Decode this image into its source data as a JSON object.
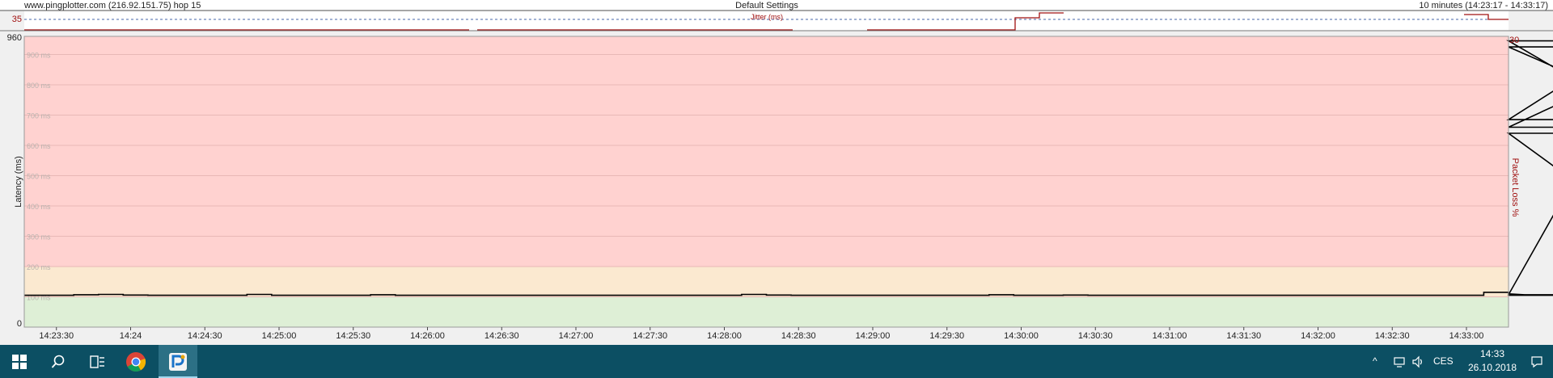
{
  "header": {
    "target": "www.pingplotter.com (216.92.151.75) hop 15",
    "settings": "Default Settings",
    "range": "10 minutes (14:23:17 - 14:33:17)"
  },
  "jitter": {
    "label": "Jitter (ms)",
    "scale_value": "35"
  },
  "chart_data": {
    "type": "line",
    "title": "",
    "ylabel": "Latency (ms)",
    "y2label": "Packet Loss %",
    "ylim": [
      0,
      960
    ],
    "y_top_label": "960",
    "y_bottom_label": "0",
    "y2_top_label": "30",
    "grid_labels": [
      "100 ms",
      "200 ms",
      "300 ms",
      "400 ms",
      "500 ms",
      "600 ms",
      "700 ms",
      "800 ms",
      "900 ms"
    ],
    "grid_values": [
      100,
      200,
      300,
      400,
      500,
      600,
      700,
      800,
      900
    ],
    "zones": [
      {
        "name": "good",
        "from": 0,
        "to": 100,
        "color": "#deefd6"
      },
      {
        "name": "warning",
        "from": 100,
        "to": 200,
        "color": "#fbe9d0"
      },
      {
        "name": "bad",
        "from": 200,
        "to": 960,
        "color": "#ffd2d0"
      }
    ],
    "x_range": [
      "14:23:17",
      "14:33:17"
    ],
    "x_ticks": [
      {
        "t": "14:23:30",
        "label": "14:23:30"
      },
      {
        "t": "14:24:00",
        "label": "14:24"
      },
      {
        "t": "14:24:30",
        "label": "14:24:30"
      },
      {
        "t": "14:25:00",
        "label": "14:25:00"
      },
      {
        "t": "14:25:30",
        "label": "14:25:30"
      },
      {
        "t": "14:26:00",
        "label": "14:26:00"
      },
      {
        "t": "14:26:30",
        "label": "14:26:30"
      },
      {
        "t": "14:27:00",
        "label": "14:27:00"
      },
      {
        "t": "14:27:30",
        "label": "14:27:30"
      },
      {
        "t": "14:28:00",
        "label": "14:28:00"
      },
      {
        "t": "14:28:30",
        "label": "14:28:30"
      },
      {
        "t": "14:29:00",
        "label": "14:29:00"
      },
      {
        "t": "14:29:30",
        "label": "14:29:30"
      },
      {
        "t": "14:30:00",
        "label": "14:30:00"
      },
      {
        "t": "14:30:30",
        "label": "14:30:30"
      },
      {
        "t": "14:31:00",
        "label": "14:31:00"
      },
      {
        "t": "14:31:30",
        "label": "14:31:30"
      },
      {
        "t": "14:32:00",
        "label": "14:32:00"
      },
      {
        "t": "14:32:30",
        "label": "14:32:30"
      },
      {
        "t": "14:33:00",
        "label": "14:33:00"
      }
    ],
    "series": [
      {
        "color": "#000000",
        "step_start": "14:23:17",
        "step_seconds": 10,
        "values": [
          105,
          105,
          107,
          108,
          106,
          105,
          105,
          105,
          105,
          108,
          105,
          105,
          105,
          105,
          107,
          105,
          105,
          105,
          105,
          105,
          105,
          105,
          105,
          105,
          105,
          105,
          105,
          105,
          105,
          108,
          106,
          105,
          105,
          105,
          105,
          105,
          105,
          105,
          105,
          107,
          105,
          105,
          106,
          105,
          105,
          105,
          105,
          105,
          105,
          105,
          105,
          105,
          105,
          105,
          105,
          105,
          105,
          105,
          105,
          115,
          110,
          105,
          105,
          107,
          685,
          945,
          660,
          925,
          640,
          105,
          105,
          105,
          105,
          105,
          105,
          105,
          105,
          105,
          105,
          105,
          105,
          105,
          106,
          105,
          105,
          105,
          105,
          105,
          105,
          105,
          105,
          105,
          105,
          105,
          105,
          105,
          105,
          107,
          105,
          105,
          105,
          105,
          105,
          105,
          105,
          105,
          105,
          105,
          105,
          105,
          105,
          105,
          105,
          105,
          106,
          105,
          105,
          105,
          105,
          105,
          105,
          105,
          105,
          105,
          105
        ]
      }
    ]
  },
  "taskbar": {
    "clock_time": "14:33",
    "clock_date": "26.10.2018",
    "language": "CES"
  }
}
